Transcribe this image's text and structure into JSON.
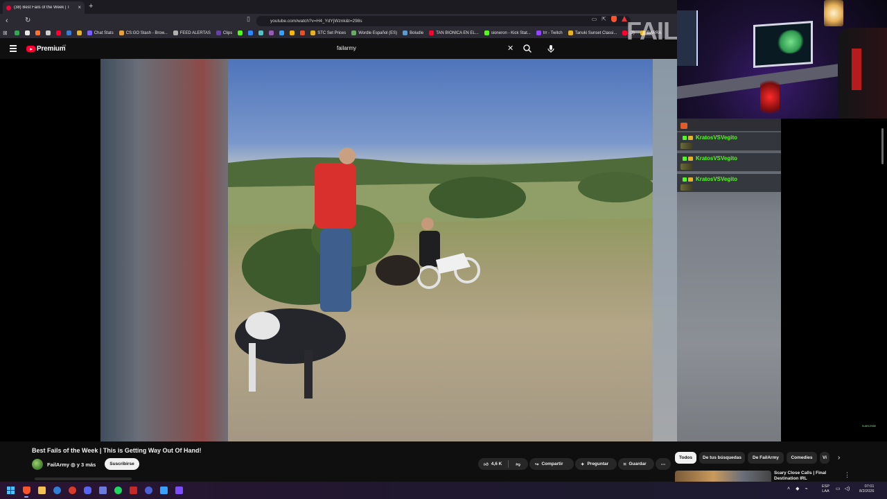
{
  "browser": {
    "tab_title": "(38) Best Fails of the Week | T",
    "url": "youtube.com/watch?v=H4_YdYjWznk&t=298s",
    "bookmarks": [
      {
        "label": "",
        "color": "#2fa84f"
      },
      {
        "label": "",
        "color": "#e8e8e8"
      },
      {
        "label": "",
        "color": "#ff7139"
      },
      {
        "label": "",
        "color": "#cfcfcf"
      },
      {
        "label": "",
        "color": "#ff0033"
      },
      {
        "label": "",
        "color": "#3a7bd5"
      },
      {
        "label": "",
        "color": "#e6b422"
      },
      {
        "label": "Chat Stats",
        "color": "#7b61ff"
      },
      {
        "label": "CS:GO Stash - Brow...",
        "color": "#e6a23c"
      },
      {
        "label": "FEED ALERTAS",
        "color": "#b0b0b0"
      },
      {
        "label": "Clips",
        "color": "#6441a5"
      },
      {
        "label": "",
        "color": "#53fc18"
      },
      {
        "label": "",
        "color": "#2d88ff"
      },
      {
        "label": "",
        "color": "#53c2c2"
      },
      {
        "label": "",
        "color": "#9b59b6"
      },
      {
        "label": "",
        "color": "#3aa0ff"
      },
      {
        "label": "",
        "color": "#f0b90b"
      },
      {
        "label": "",
        "color": "#f04e23"
      },
      {
        "label": "STC Set Prices",
        "color": "#e6b422"
      },
      {
        "label": "Wordle Español (ES)",
        "color": "#6aaa64"
      },
      {
        "label": "Boludle",
        "color": "#5a9bd4"
      },
      {
        "label": "TAN BIONICA EN EL...",
        "color": "#ff0033"
      },
      {
        "label": "sioneron - Kick Stat...",
        "color": "#53fc18"
      },
      {
        "label": "trr - Twitch",
        "color": "#9146ff"
      },
      {
        "label": "Tanuki Sunset Classi...",
        "color": "#e6b422"
      },
      {
        "label": "(2)",
        "color": "#ff0033"
      },
      {
        "label": "BARRA",
        "color": "#e6b422"
      }
    ]
  },
  "youtube": {
    "brand": "Premium",
    "region": "AR",
    "search_value": "failarmy"
  },
  "video": {
    "watermark": "FAIL",
    "title": "Best Fails of the Week | This is Getting Way Out Of Hand!",
    "channel": "FailArmy ◎ y 3 más",
    "subscribe": "Suscribirse",
    "likes": "4,6 K",
    "share": "Compartir",
    "ask": "Preguntar",
    "save": "Guardar",
    "more": "⋯"
  },
  "chat": {
    "messages": [
      {
        "user": "KratosVSVegito"
      },
      {
        "user": "KratosVSVegito"
      },
      {
        "user": "KratosVSVegito"
      }
    ],
    "tiny": "SUBSCRIBE"
  },
  "recommendations": {
    "chips": [
      "Todos",
      "De tus búsquedas",
      "De FailArmy",
      "Comedies",
      "Vi"
    ],
    "first_title": "Scary Close Calls | Final Destination IRL"
  },
  "taskbar": {
    "lang": "ESP",
    "lang2": "LAA",
    "time": "07:01",
    "date": "8/2/2026"
  }
}
